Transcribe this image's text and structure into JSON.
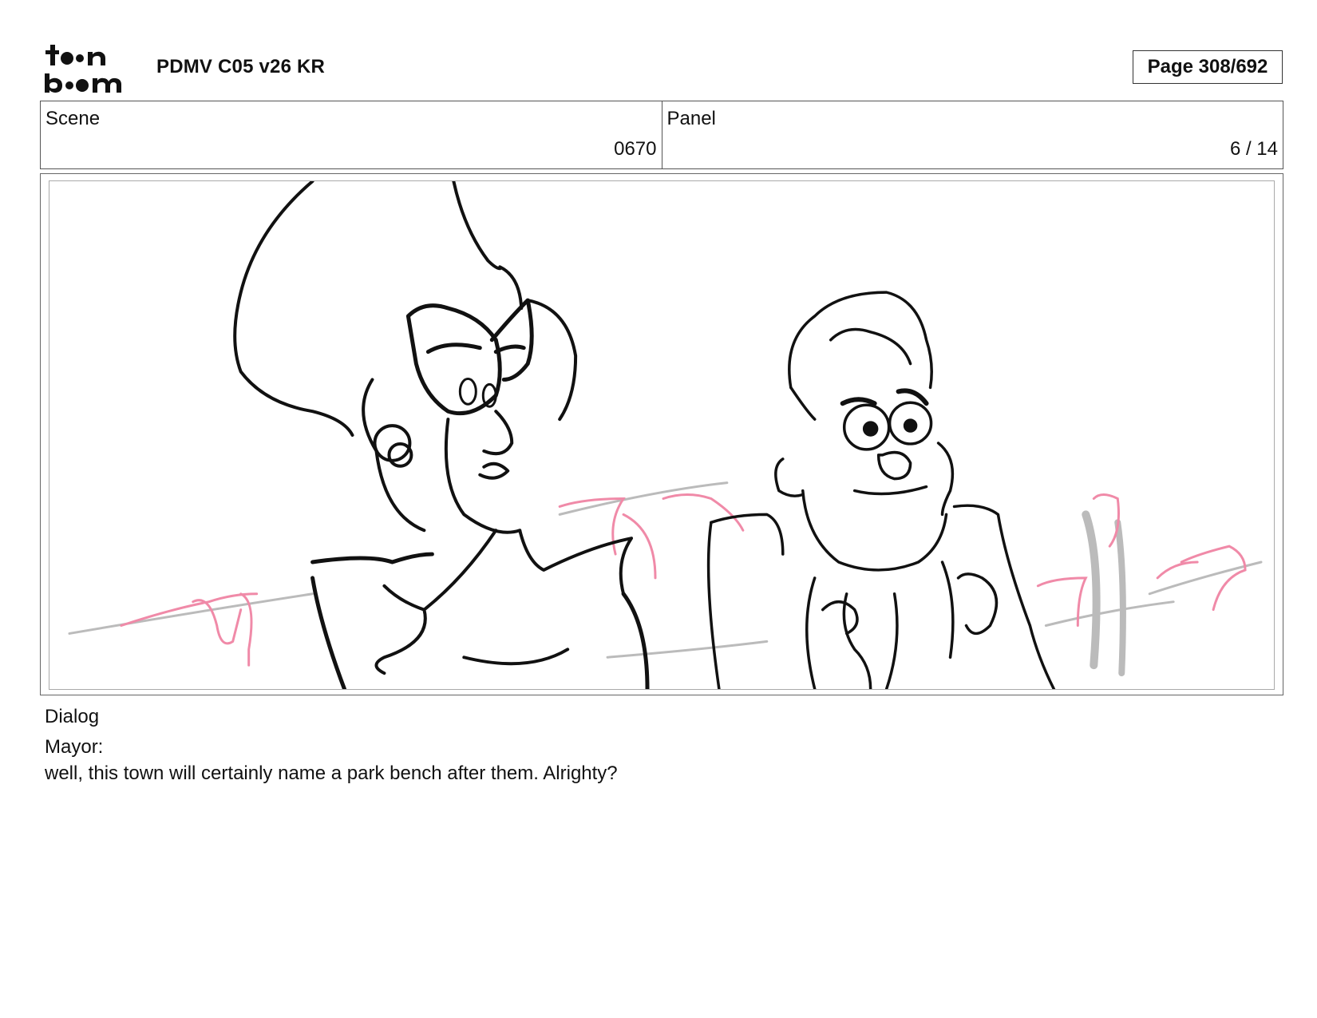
{
  "header": {
    "logo_text": "toonboom",
    "document_title": "PDMV C05 v26 KR",
    "page_indicator": "Page 308/692"
  },
  "info": {
    "scene_label": "Scene",
    "scene_value": "0670",
    "panel_label": "Panel",
    "panel_value": "6 / 14"
  },
  "panel_image": {
    "icon": "storyboard-sketch",
    "description_colors": {
      "line": "#111111",
      "rough": "#f08aa8",
      "guide": "#bbbbbb"
    }
  },
  "dialog": {
    "label": "Dialog",
    "speaker": "Mayor:",
    "line": "well, this town will certainly name a park bench after them. Alrighty?"
  }
}
